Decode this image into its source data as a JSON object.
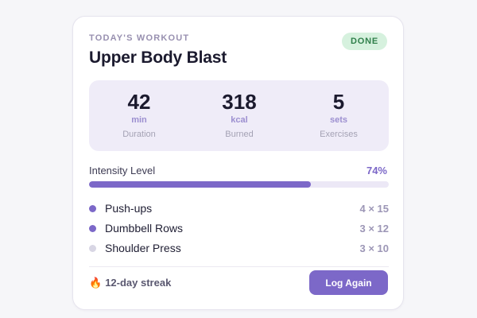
{
  "card": {
    "eyebrow": "TODAY'S WORKOUT",
    "title": "Upper Body Blast",
    "status_badge": "DONE"
  },
  "stats": [
    {
      "value": "42",
      "unit": "min",
      "label": "Duration"
    },
    {
      "value": "318",
      "unit": "kcal",
      "label": "Burned"
    },
    {
      "value": "5",
      "unit": "sets",
      "label": "Exercises"
    }
  ],
  "intensity": {
    "label": "Intensity Level",
    "value_text": "74%",
    "fraction": 0.74
  },
  "exercises": [
    {
      "name": "Push-ups",
      "sets": "4 × 15",
      "completed": true
    },
    {
      "name": "Dumbbell Rows",
      "sets": "3 × 12",
      "completed": true
    },
    {
      "name": "Shoulder Press",
      "sets": "3 × 10",
      "completed": false
    }
  ],
  "footer": {
    "streak_icon": "flame-icon",
    "streak_text": "12-day streak",
    "log_button": "Log Again"
  },
  "colors": {
    "accent": "#7c68c8",
    "badge_bg": "#d6f1de",
    "badge_text": "#2f7f4a",
    "dot_done": "#7c68c8",
    "dot_pending": "#d8d6e4"
  }
}
